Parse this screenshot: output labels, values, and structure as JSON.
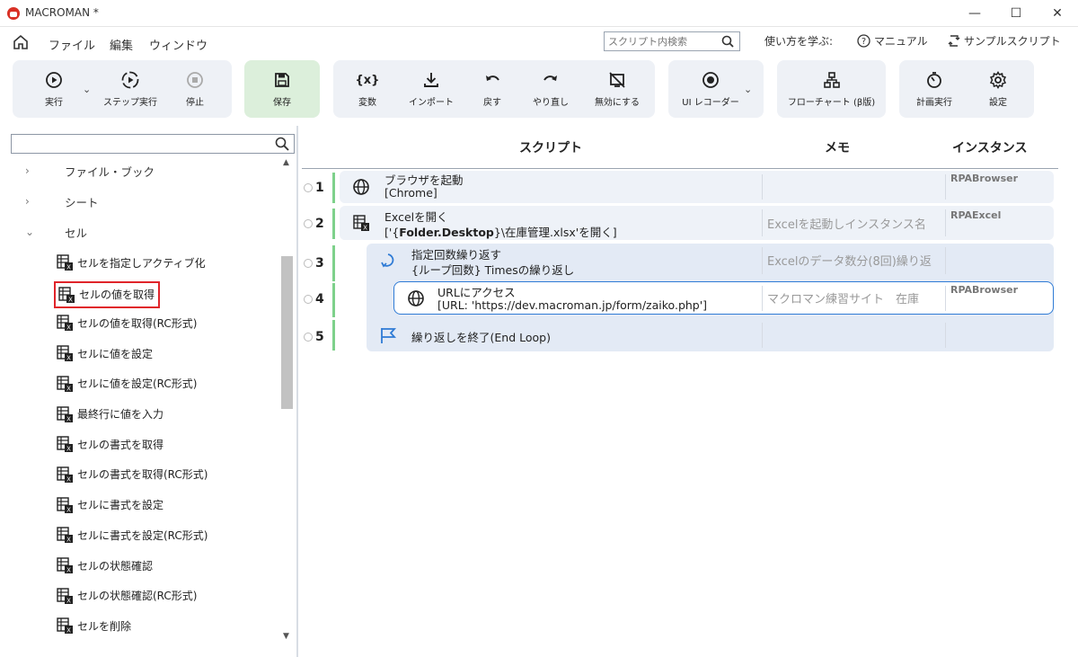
{
  "window": {
    "title": "MACROMAN *",
    "min": "—",
    "max": "☐",
    "close": "✕"
  },
  "menu": {
    "items": [
      "ファイル",
      "編集",
      "ウィンドウ"
    ],
    "search_placeholder": "スクリプト内検索",
    "learn_label": "使い方を学ぶ:",
    "manual": "マニュアル",
    "samples": "サンプルスクリプト"
  },
  "toolbar": {
    "run": "実行",
    "step_run": "ステップ実行",
    "stop": "停止",
    "save": "保存",
    "variables": "変数",
    "variables_glyph": "{x}",
    "import": "インポート",
    "undo": "戻す",
    "redo": "やり直し",
    "disable": "無効にする",
    "ui_recorder": "UI レコーダー",
    "flowchart": "フローチャート (β版)",
    "schedule": "計画実行",
    "settings": "設定"
  },
  "sidebar": {
    "search_value": "",
    "categories": [
      {
        "label": "ファイル・ブック",
        "expanded": false
      },
      {
        "label": "シート",
        "expanded": false
      },
      {
        "label": "セル",
        "expanded": true
      }
    ],
    "commands": [
      "セルを指定しアクティブ化",
      "セルの値を取得",
      "セルの値を取得(RC形式)",
      "セルに値を設定",
      "セルに値を設定(RC形式)",
      "最終行に値を入力",
      "セルの書式を取得",
      "セルの書式を取得(RC形式)",
      "セルに書式を設定",
      "セルに書式を設定(RC形式)",
      "セルの状態確認",
      "セルの状態確認(RC形式)",
      "セルを削除"
    ],
    "selected_index": 1
  },
  "script": {
    "headers": {
      "script": "スクリプト",
      "memo": "メモ",
      "instance": "インスタンス"
    },
    "steps": [
      {
        "num": "1",
        "title": "ブラウザを起動",
        "sub": "[Chrome]",
        "memo": "",
        "instance": "RPABrowser",
        "icon": "globe-icon"
      },
      {
        "num": "2",
        "title": "Excelを開く",
        "sub_pre": "['{",
        "sub_bold": "Folder.Desktop",
        "sub_post": "}\\在庫管理.xlsx'を開く]",
        "memo": "Excelを起動しインスタンス名",
        "instance": "RPAExcel",
        "icon": "excel-icon"
      },
      {
        "num": "3",
        "title": "指定回数繰り返す",
        "sub": "{ループ回数} Timesの繰り返し",
        "memo": "Excelのデータ数分(8回)繰り返",
        "instance": "",
        "icon": "loop-icon"
      },
      {
        "num": "4",
        "title": "URLにアクセス",
        "sub": "[URL: 'https://dev.macroman.jp/form/zaiko.php']",
        "memo": "マクロマン練習サイト　在庫",
        "instance": "RPABrowser",
        "icon": "globe-icon"
      },
      {
        "num": "5",
        "title": "繰り返しを終了(End Loop)",
        "sub": "",
        "memo": "",
        "instance": "",
        "icon": "flag-icon"
      }
    ]
  },
  "colors": {
    "accent": "#2f7bd5",
    "selected_border": "#e0242a",
    "save_bg": "#dcefdb",
    "toolbar_bg": "#eef1f6",
    "step_bg": "#eef2f8",
    "green_bar": "#7ed18b"
  }
}
